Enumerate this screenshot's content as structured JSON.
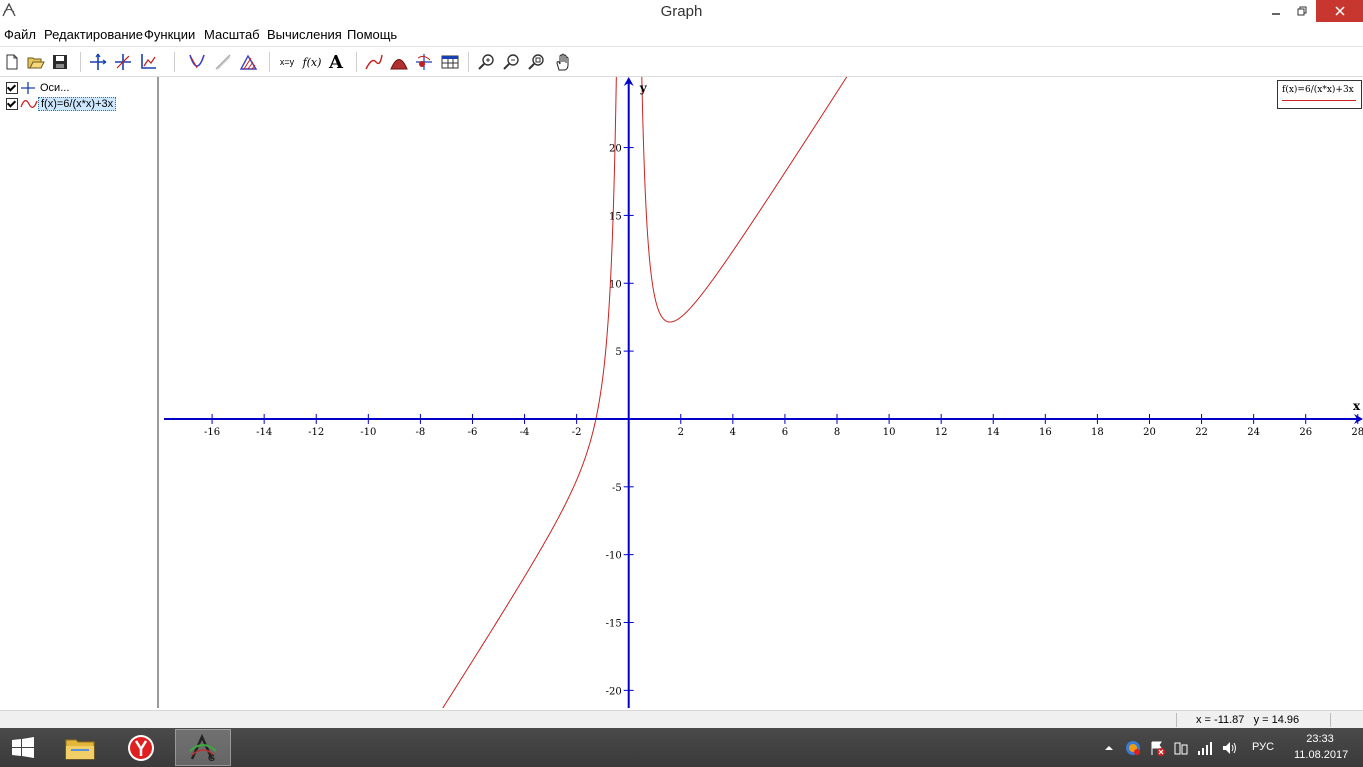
{
  "window": {
    "title": "Graph"
  },
  "menu": [
    "Файл",
    "Редактирование",
    "Функции",
    "Масштаб",
    "Вычисления",
    "Помощь"
  ],
  "toolbar": {
    "xy_label": "x=y",
    "fx_label": "f(x)",
    "text_label": "A"
  },
  "tree": {
    "axes_label": "Оси...",
    "function_label": "f(x)=6/(x*x)+3x"
  },
  "legend": {
    "text": "f(x)=6/(x*x)+3x",
    "color": "#cc2222"
  },
  "chart_data": {
    "type": "line",
    "function": "f(x)=6/(x*x)+3x",
    "x_ticks": [
      "-16",
      "-14",
      "-12",
      "-10",
      "-8",
      "-6",
      "-4",
      "-2",
      "2",
      "4",
      "6",
      "8",
      "10",
      "12",
      "14",
      "16",
      "18",
      "20",
      "22",
      "24",
      "26",
      "28"
    ],
    "y_ticks": [
      "20",
      "15",
      "10",
      "5",
      "-5",
      "-10",
      "-15",
      "-20"
    ],
    "xlabel": "x",
    "ylabel": "y",
    "xlim": [
      -18,
      28.2
    ],
    "ylim": [
      -21.3,
      25.2
    ],
    "series": [
      {
        "name": "f(x)=6/(x*x)+3x",
        "color": "#cc2222"
      }
    ],
    "axis_color": "#0000c8"
  },
  "status": {
    "x": "x = -11.87",
    "y": "y = 14.96"
  },
  "taskbar": {
    "lang": "РУС",
    "time": "23:33",
    "date": "11.08.2017"
  }
}
